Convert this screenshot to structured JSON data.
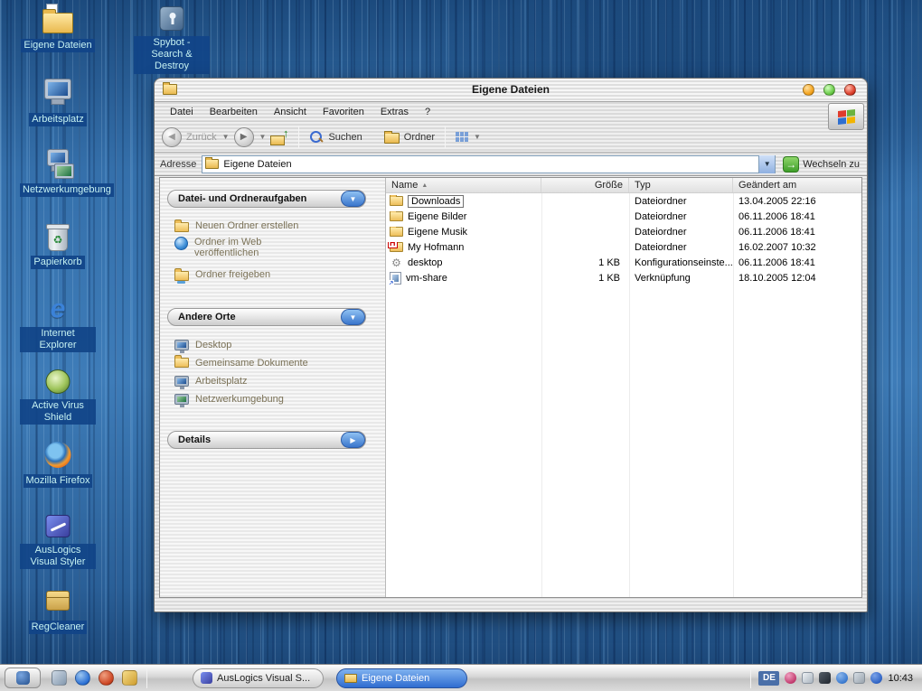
{
  "desktop": {
    "icons": [
      {
        "label": "Eigene Dateien",
        "icon": "my-documents-folder"
      },
      {
        "label": "Spybot - Search & Destroy",
        "icon": "spybot"
      },
      {
        "label": "Arbeitsplatz",
        "icon": "computer"
      },
      {
        "label": "Netzwerkumgebung",
        "icon": "network"
      },
      {
        "label": "Papierkorb",
        "icon": "recycle-bin"
      },
      {
        "label": "Internet Explorer",
        "icon": "internet-explorer"
      },
      {
        "label": "Active Virus Shield",
        "icon": "shield"
      },
      {
        "label": "Mozilla Firefox",
        "icon": "firefox"
      },
      {
        "label": "AusLogics Visual Styler",
        "icon": "visual-styler"
      },
      {
        "label": "RegCleaner",
        "icon": "regcleaner"
      }
    ]
  },
  "window": {
    "title": "Eigene Dateien",
    "menu": {
      "items": [
        "Datei",
        "Bearbeiten",
        "Ansicht",
        "Favoriten",
        "Extras",
        "?"
      ]
    },
    "toolbar": {
      "back_label": "Zurück",
      "search_label": "Suchen",
      "folders_label": "Ordner"
    },
    "addressbar": {
      "label": "Adresse",
      "value": "Eigene Dateien",
      "go_label": "Wechseln zu"
    },
    "taskpane": {
      "file_tasks": {
        "title": "Datei- und Ordneraufgaben",
        "items": [
          "Neuen Ordner erstellen",
          "Ordner im Web veröffentlichen",
          "Ordner freigeben"
        ]
      },
      "other_places": {
        "title": "Andere Orte",
        "items": [
          "Desktop",
          "Gemeinsame Dokumente",
          "Arbeitsplatz",
          "Netzwerkumgebung"
        ]
      },
      "details": {
        "title": "Details"
      }
    },
    "filelist": {
      "columns": [
        "Name",
        "Größe",
        "Typ",
        "Geändert am"
      ],
      "sort": "ascending",
      "rows": [
        {
          "name": "Downloads",
          "size": "",
          "type": "Dateiordner",
          "modified": "13.04.2005 22:16",
          "icon": "folder",
          "selected": true
        },
        {
          "name": "Eigene Bilder",
          "size": "",
          "type": "Dateiordner",
          "modified": "06.11.2006 18:41",
          "icon": "folder",
          "selected": false
        },
        {
          "name": "Eigene Musik",
          "size": "",
          "type": "Dateiordner",
          "modified": "06.11.2006 18:41",
          "icon": "folder",
          "selected": false
        },
        {
          "name": "My Hofmann",
          "size": "",
          "type": "Dateiordner",
          "modified": "16.02.2007 10:32",
          "icon": "folder-h",
          "selected": false
        },
        {
          "name": "desktop",
          "size": "1 KB",
          "type": "Konfigurationseinste...",
          "modified": "06.11.2006 18:41",
          "icon": "config",
          "selected": false
        },
        {
          "name": "vm-share",
          "size": "1 KB",
          "type": "Verknüpfung",
          "modified": "18.10.2005 12:04",
          "icon": "shortcut",
          "selected": false
        }
      ]
    }
  },
  "taskbar": {
    "tasks": [
      {
        "label": "AusLogics Visual S...",
        "active": false
      },
      {
        "label": "Eigene Dateien",
        "active": true
      }
    ],
    "tray": {
      "language": "DE",
      "clock": "10:43"
    }
  },
  "colors": {
    "accent_blue": "#2f6cd0",
    "go_green": "#3f9e2a",
    "selection_blue": "#114488"
  }
}
